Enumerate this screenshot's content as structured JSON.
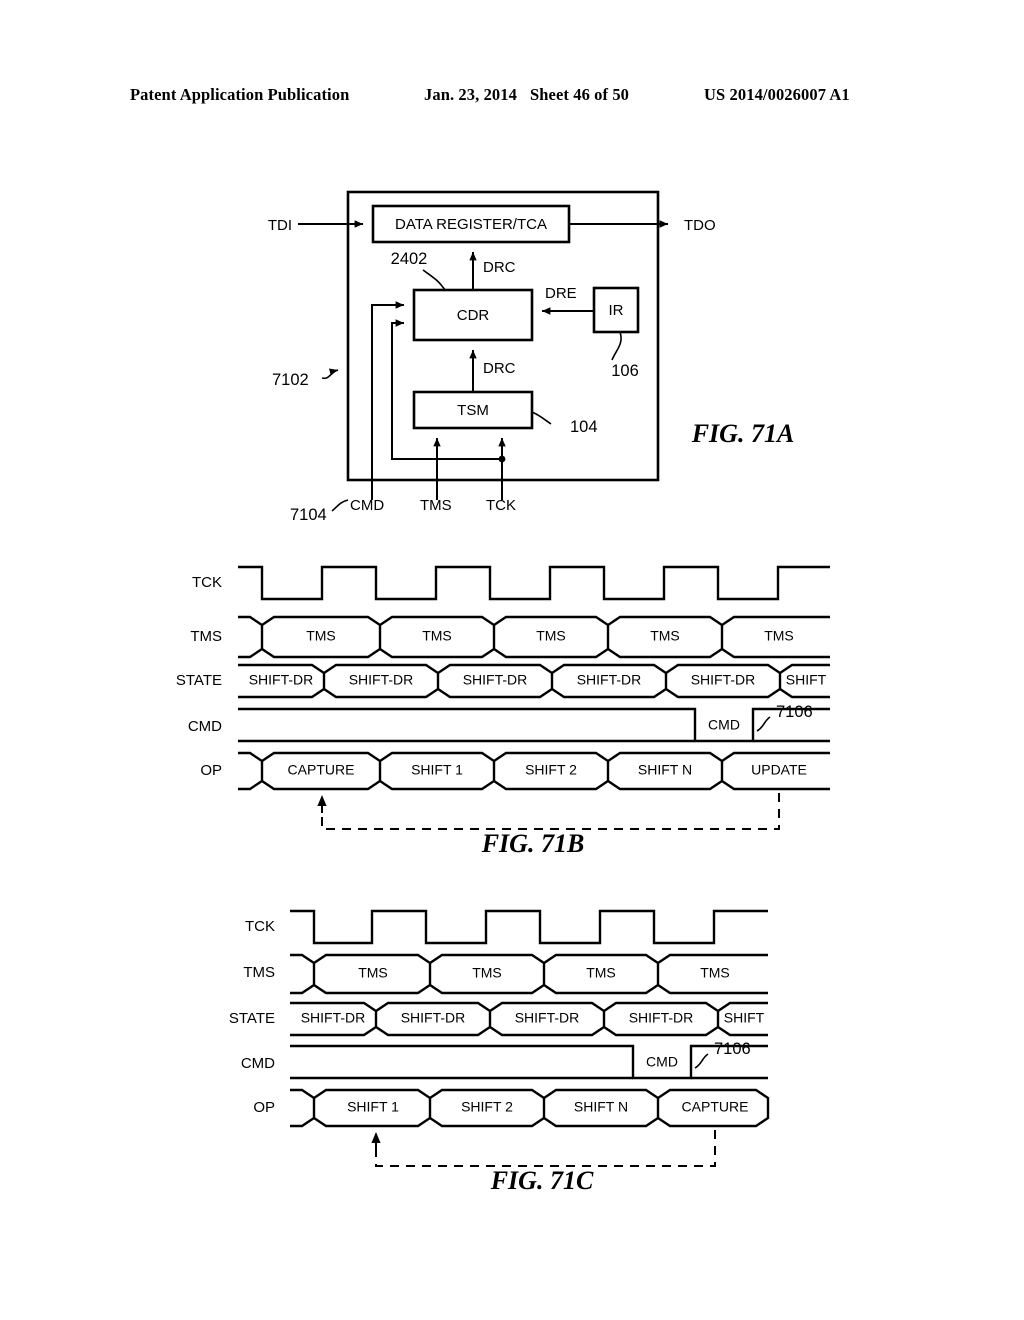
{
  "header": {
    "publication": "Patent Application Publication",
    "date": "Jan. 23, 2014",
    "sheet": "Sheet 46 of 50",
    "doc_id": "US 2014/0026007 A1"
  },
  "fig71a": {
    "caption": "FIG. 71A",
    "blocks": {
      "data_register": "DATA REGISTER/TCA",
      "cdr": "CDR",
      "ir": "IR",
      "tsm": "TSM"
    },
    "ports": {
      "tdi": "TDI",
      "tdo": "TDO",
      "cmd": "CMD",
      "tms": "TMS",
      "tck": "TCK"
    },
    "signals": {
      "drc_top": "DRC",
      "drc_mid": "DRC",
      "dre": "DRE"
    },
    "refs": {
      "ref_2402": "2402",
      "ref_106": "106",
      "ref_104": "104",
      "ref_7102": "7102",
      "ref_7104": "7104"
    }
  },
  "fig71b": {
    "caption": "FIG. 71B",
    "row_labels": {
      "tck": "TCK",
      "tms": "TMS",
      "state": "STATE",
      "cmd": "CMD",
      "op": "OP"
    },
    "tms_segments": [
      "TMS",
      "TMS",
      "TMS",
      "TMS",
      "TMS"
    ],
    "state_segments": [
      "SHIFT-DR",
      "SHIFT-DR",
      "SHIFT-DR",
      "SHIFT-DR",
      "SHIFT-DR",
      "SHIFT"
    ],
    "cmd_pulse_label": "CMD",
    "cmd_ref": "7106",
    "op_segments": [
      "CAPTURE",
      "SHIFT 1",
      "SHIFT 2",
      "SHIFT N",
      "UPDATE"
    ]
  },
  "fig71c": {
    "caption": "FIG. 71C",
    "row_labels": {
      "tck": "TCK",
      "tms": "TMS",
      "state": "STATE",
      "cmd": "CMD",
      "op": "OP"
    },
    "tms_segments": [
      "TMS",
      "TMS",
      "TMS",
      "TMS"
    ],
    "state_segments": [
      "SHIFT-DR",
      "SHIFT-DR",
      "SHIFT-DR",
      "SHIFT-DR",
      "SHIFT"
    ],
    "cmd_pulse_label": "CMD",
    "cmd_ref": "7106",
    "op_segments": [
      "SHIFT 1",
      "SHIFT 2",
      "SHIFT N",
      "CAPTURE"
    ]
  }
}
